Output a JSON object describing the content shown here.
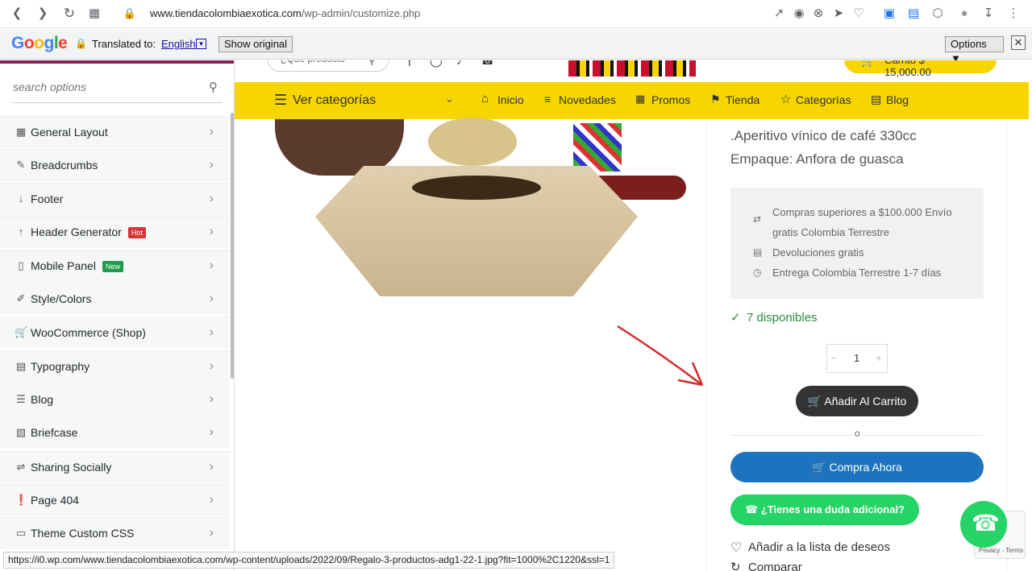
{
  "browser": {
    "url_domain": "www.tiendacolombiaexotica.com",
    "url_path": "/wp-admin/customize.php"
  },
  "translate_bar": {
    "logo": "Google",
    "translated_to_label": "Translated to:",
    "language": "English",
    "show_original": "Show original",
    "options": "Options ▼"
  },
  "sidebar": {
    "search_placeholder": "search options",
    "items": [
      {
        "label": "General Layout",
        "icon": "layout-icon"
      },
      {
        "label": "Breadcrumbs",
        "icon": "brush-icon"
      },
      {
        "label": "Footer",
        "icon": "arrow-down-icon"
      },
      {
        "label": "Header Generator",
        "icon": "arrow-up-icon",
        "badge": "Hot",
        "badge_color": "#d63638"
      },
      {
        "label": "Mobile Panel",
        "icon": "mobile-icon",
        "badge": "New",
        "badge_color": "#1e9c4a"
      },
      {
        "label": "Style/Colors",
        "icon": "paint-icon"
      },
      {
        "label": "WooCommerce (Shop)",
        "icon": "cart-icon"
      },
      {
        "label": "Typography",
        "icon": "document-icon"
      },
      {
        "label": "Blog",
        "icon": "list-icon"
      },
      {
        "label": "Briefcase",
        "icon": "image-icon"
      },
      {
        "label": "Sharing Socially",
        "icon": "share-icon"
      },
      {
        "label": "Page 404",
        "icon": "alert-icon"
      },
      {
        "label": "Theme Custom CSS",
        "icon": "code-icon"
      }
    ]
  },
  "site": {
    "search_placeholder": "¿Qué producto",
    "cart_label": "Carrito $ 15,000.00",
    "nav": {
      "categories": "Ver categorías",
      "items": [
        "Inicio",
        "Novedades",
        "Promos",
        "Tienda",
        "Categorías",
        "Blog"
      ]
    }
  },
  "product": {
    "line1": ".Aperitivo vínico de café 330cc",
    "line2": "Empaque: Anfora de guasca",
    "info": [
      "Compras superiores a $100.000 Envío",
      "gratis Colombia Terrestre",
      "Devoluciones gratis",
      "Entrega Colombia Terrestre 1-7 días"
    ],
    "stock": "7 disponibles",
    "qty": "1",
    "add_to_cart": "Añadir Al Carrito",
    "divider_or": "o",
    "buy_now": "Compra Ahora",
    "whatsapp_question": "¿Tienes una duda adicional?",
    "wishlist": "Añadir a la lista de deseos",
    "compare": "Comparar"
  },
  "status_url": "https://i0.wp.com/www.tiendacolombiaexotica.com/wp-content/uploads/2022/09/Regalo-3-productos-adg1-22-1.jpg?fit=1000%2C1220&ssl=1",
  "recaptcha": "Privacy - Terms",
  "colors": {
    "nav_yellow": "#f6d500",
    "buy_blue": "#1e73be",
    "whatsapp_green": "#25d366",
    "stock_green": "#2e8b3e"
  }
}
